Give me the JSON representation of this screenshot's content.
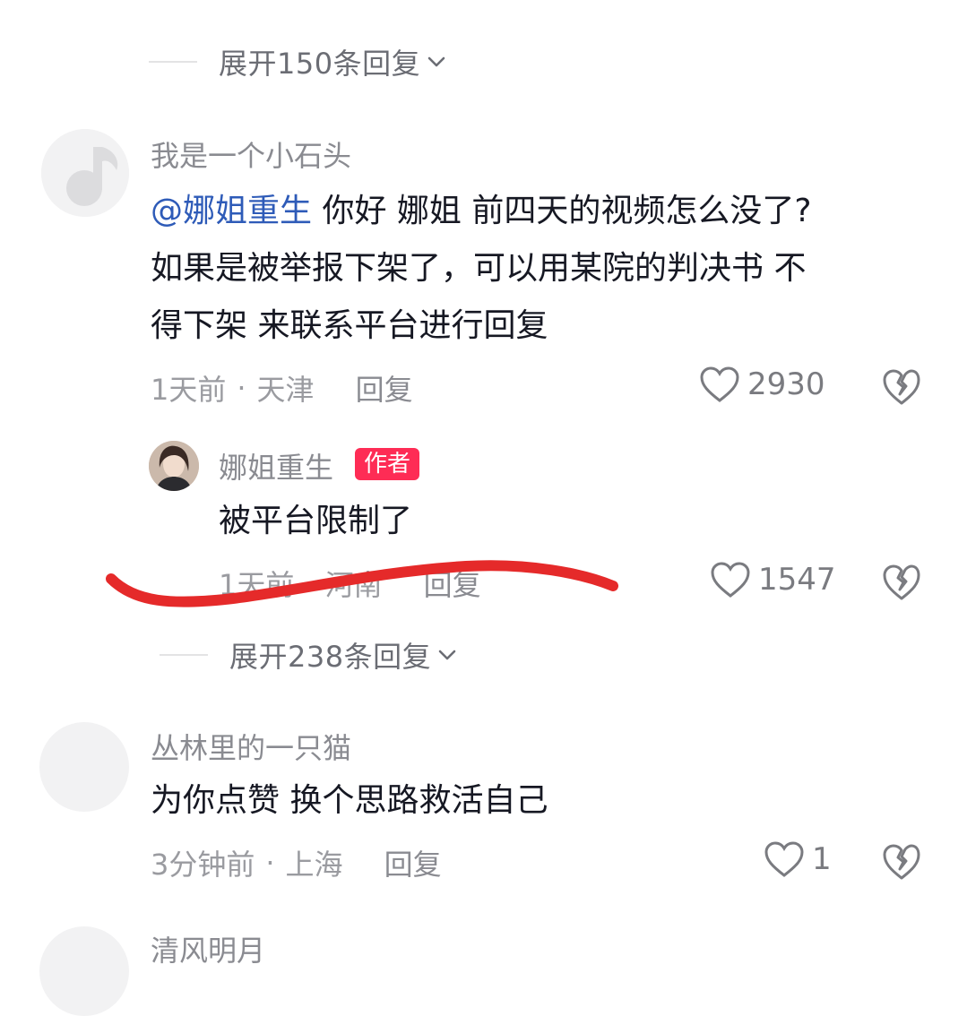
{
  "expand_top": {
    "label": "展开150条回复"
  },
  "comment1": {
    "username": "我是一个小石头",
    "mention": "@娜姐重生",
    "text_line1": " 你好 娜姐 前四天的视频怎么没了?",
    "text_line2": "如果是被举报下架了，可以用某院的判决书 不",
    "text_line3": "得下架 来联系平台进行回复",
    "time": "1天前",
    "location": "天津",
    "reply_label": "回复",
    "likes": "2930"
  },
  "reply1": {
    "username": "娜姐重生",
    "badge": "作者",
    "text": "被平台限制了",
    "time": "1天前",
    "location": "河南",
    "reply_label": "回复",
    "likes": "1547"
  },
  "expand_mid": {
    "label": "展开238条回复"
  },
  "comment2": {
    "username": "丛林里的一只猫",
    "text": "为你点赞  换个思路救活自己",
    "time": "3分钟前",
    "location": "上海",
    "reply_label": "回复",
    "likes": "1"
  },
  "comment3": {
    "username": "清风明月"
  },
  "colors": {
    "mention": "#2e5bb8",
    "author_badge": "#fe2c55",
    "annotation_stroke": "#e52a2a"
  },
  "meta_separator": "·"
}
